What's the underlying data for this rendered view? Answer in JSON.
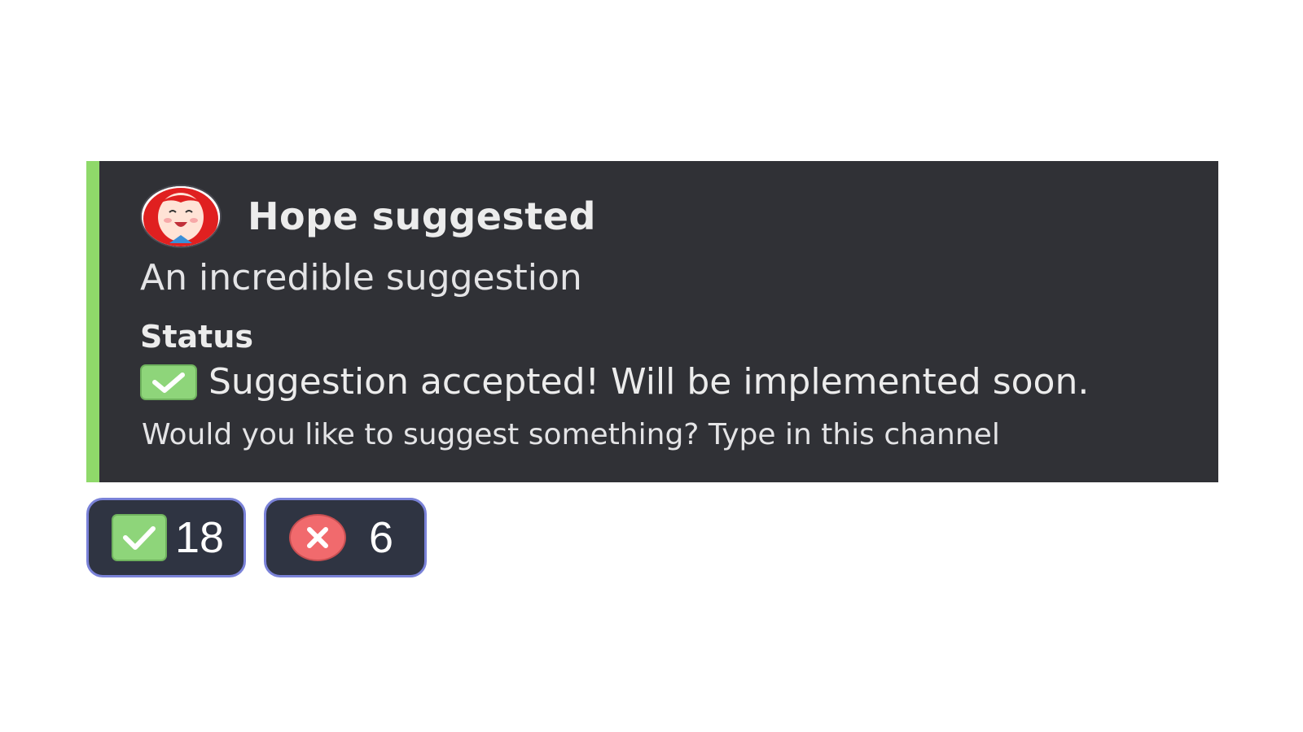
{
  "embed": {
    "accent_color": "#8fd96a",
    "background_color": "#303136",
    "author": {
      "name": "Hope suggested",
      "avatar_icon": "anime-girl-avatar"
    },
    "description": "An incredible suggestion",
    "field": {
      "name": "Status",
      "value": "Suggestion accepted! Will be implemented soon.",
      "icon": "check-mark-icon"
    },
    "footer": "Would you like to suggest something? Type in this channel"
  },
  "reactions": [
    {
      "icon": "check-mark-icon",
      "count": "18",
      "color": "#8ed57a"
    },
    {
      "icon": "cross-mark-icon",
      "count": "6",
      "color": "#f16a6d"
    }
  ]
}
